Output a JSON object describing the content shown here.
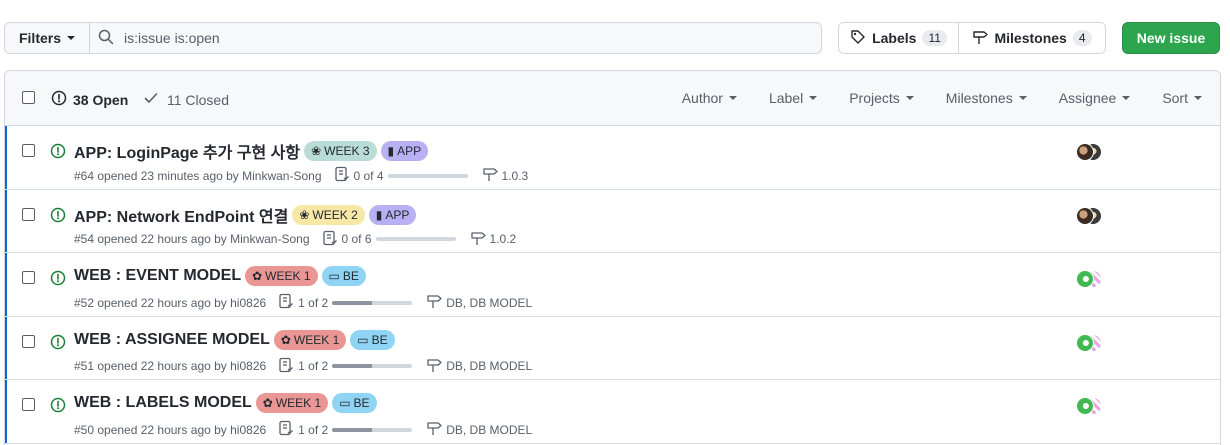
{
  "toolbar": {
    "filters_label": "Filters",
    "search_value": "is:issue is:open",
    "labels_label": "Labels",
    "labels_count": "11",
    "milestones_label": "Milestones",
    "milestones_count": "4",
    "new_issue_label": "New issue"
  },
  "header": {
    "open_label": "38 Open",
    "closed_label": "11 Closed",
    "filters": [
      "Author",
      "Label",
      "Projects",
      "Milestones",
      "Assignee",
      "Sort"
    ]
  },
  "colors": {
    "primary_button": "#2da44e",
    "open_icon": "#1a7f37",
    "week3": "#b9dcd6",
    "week2": "#f7e8a6",
    "week1": "#e99695",
    "app": "#b8b0f2",
    "be": "#8fd3f5"
  },
  "issues": [
    {
      "title": "APP: LoginPage 추가 구현 사항",
      "labels": [
        {
          "text": "WEEK 3",
          "color": "#b9dcd6",
          "icon": "flower-icon"
        },
        {
          "text": "APP",
          "color": "#b8b0f2",
          "icon": "phone-icon"
        }
      ],
      "meta": "#64 opened 23 minutes ago by Minkwan-Song",
      "tasks": "0 of 4",
      "progress": 0.0,
      "milestone": "1.0.3",
      "assignee_avatars": [
        "avatar-a",
        "avatar-b"
      ]
    },
    {
      "title": "APP: Network EndPoint 연결",
      "labels": [
        {
          "text": "WEEK 2",
          "color": "#f7e8a6",
          "icon": "flower-icon"
        },
        {
          "text": "APP",
          "color": "#b8b0f2",
          "icon": "phone-icon"
        }
      ],
      "meta": "#54 opened 22 hours ago by Minkwan-Song",
      "tasks": "0 of 6",
      "progress": 0.0,
      "milestone": "1.0.2",
      "assignee_avatars": [
        "avatar-a",
        "avatar-b"
      ]
    },
    {
      "title": "WEB : EVENT MODEL",
      "labels": [
        {
          "text": "WEEK 1",
          "color": "#e99695",
          "icon": "tulip-icon"
        },
        {
          "text": "BE",
          "color": "#8fd3f5",
          "icon": "computer-icon"
        }
      ],
      "meta": "#52 opened 22 hours ago by hi0826",
      "tasks": "1 of 2",
      "progress": 0.5,
      "milestone": "DB, DB MODEL",
      "assignee_avatars": [
        "avatar-c",
        "avatar-d"
      ]
    },
    {
      "title": "WEB : ASSIGNEE MODEL",
      "labels": [
        {
          "text": "WEEK 1",
          "color": "#e99695",
          "icon": "tulip-icon"
        },
        {
          "text": "BE",
          "color": "#8fd3f5",
          "icon": "computer-icon"
        }
      ],
      "meta": "#51 opened 22 hours ago by hi0826",
      "tasks": "1 of 2",
      "progress": 0.5,
      "milestone": "DB, DB MODEL",
      "assignee_avatars": [
        "avatar-c",
        "avatar-d"
      ]
    },
    {
      "title": "WEB : LABELS MODEL",
      "labels": [
        {
          "text": "WEEK 1",
          "color": "#e99695",
          "icon": "tulip-icon"
        },
        {
          "text": "BE",
          "color": "#8fd3f5",
          "icon": "computer-icon"
        }
      ],
      "meta": "#50 opened 22 hours ago by hi0826",
      "tasks": "1 of 2",
      "progress": 0.5,
      "milestone": "DB, DB MODEL",
      "assignee_avatars": [
        "avatar-c",
        "avatar-d"
      ]
    }
  ]
}
